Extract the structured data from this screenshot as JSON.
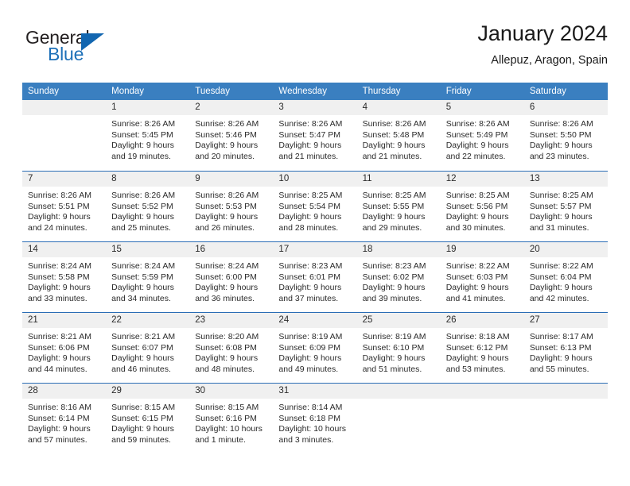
{
  "brand": {
    "word_one": "General",
    "word_two": "Blue",
    "icon": "triangle-flag-icon"
  },
  "header": {
    "title": "January 2024",
    "subtitle": "Allepuz, Aragon, Spain"
  },
  "colors": {
    "header_blue": "#3a7fc0",
    "rule_blue": "#2a6db5",
    "daynum_band": "#f0f0f0",
    "brand_blue": "#1d70b8",
    "text": "#2b2b2b"
  },
  "weekdays": [
    "Sunday",
    "Monday",
    "Tuesday",
    "Wednesday",
    "Thursday",
    "Friday",
    "Saturday"
  ],
  "weeks": [
    [
      {
        "day": "",
        "lines": []
      },
      {
        "day": "1",
        "lines": [
          "Sunrise: 8:26 AM",
          "Sunset: 5:45 PM",
          "Daylight: 9 hours",
          "and 19 minutes."
        ]
      },
      {
        "day": "2",
        "lines": [
          "Sunrise: 8:26 AM",
          "Sunset: 5:46 PM",
          "Daylight: 9 hours",
          "and 20 minutes."
        ]
      },
      {
        "day": "3",
        "lines": [
          "Sunrise: 8:26 AM",
          "Sunset: 5:47 PM",
          "Daylight: 9 hours",
          "and 21 minutes."
        ]
      },
      {
        "day": "4",
        "lines": [
          "Sunrise: 8:26 AM",
          "Sunset: 5:48 PM",
          "Daylight: 9 hours",
          "and 21 minutes."
        ]
      },
      {
        "day": "5",
        "lines": [
          "Sunrise: 8:26 AM",
          "Sunset: 5:49 PM",
          "Daylight: 9 hours",
          "and 22 minutes."
        ]
      },
      {
        "day": "6",
        "lines": [
          "Sunrise: 8:26 AM",
          "Sunset: 5:50 PM",
          "Daylight: 9 hours",
          "and 23 minutes."
        ]
      }
    ],
    [
      {
        "day": "7",
        "lines": [
          "Sunrise: 8:26 AM",
          "Sunset: 5:51 PM",
          "Daylight: 9 hours",
          "and 24 minutes."
        ]
      },
      {
        "day": "8",
        "lines": [
          "Sunrise: 8:26 AM",
          "Sunset: 5:52 PM",
          "Daylight: 9 hours",
          "and 25 minutes."
        ]
      },
      {
        "day": "9",
        "lines": [
          "Sunrise: 8:26 AM",
          "Sunset: 5:53 PM",
          "Daylight: 9 hours",
          "and 26 minutes."
        ]
      },
      {
        "day": "10",
        "lines": [
          "Sunrise: 8:25 AM",
          "Sunset: 5:54 PM",
          "Daylight: 9 hours",
          "and 28 minutes."
        ]
      },
      {
        "day": "11",
        "lines": [
          "Sunrise: 8:25 AM",
          "Sunset: 5:55 PM",
          "Daylight: 9 hours",
          "and 29 minutes."
        ]
      },
      {
        "day": "12",
        "lines": [
          "Sunrise: 8:25 AM",
          "Sunset: 5:56 PM",
          "Daylight: 9 hours",
          "and 30 minutes."
        ]
      },
      {
        "day": "13",
        "lines": [
          "Sunrise: 8:25 AM",
          "Sunset: 5:57 PM",
          "Daylight: 9 hours",
          "and 31 minutes."
        ]
      }
    ],
    [
      {
        "day": "14",
        "lines": [
          "Sunrise: 8:24 AM",
          "Sunset: 5:58 PM",
          "Daylight: 9 hours",
          "and 33 minutes."
        ]
      },
      {
        "day": "15",
        "lines": [
          "Sunrise: 8:24 AM",
          "Sunset: 5:59 PM",
          "Daylight: 9 hours",
          "and 34 minutes."
        ]
      },
      {
        "day": "16",
        "lines": [
          "Sunrise: 8:24 AM",
          "Sunset: 6:00 PM",
          "Daylight: 9 hours",
          "and 36 minutes."
        ]
      },
      {
        "day": "17",
        "lines": [
          "Sunrise: 8:23 AM",
          "Sunset: 6:01 PM",
          "Daylight: 9 hours",
          "and 37 minutes."
        ]
      },
      {
        "day": "18",
        "lines": [
          "Sunrise: 8:23 AM",
          "Sunset: 6:02 PM",
          "Daylight: 9 hours",
          "and 39 minutes."
        ]
      },
      {
        "day": "19",
        "lines": [
          "Sunrise: 8:22 AM",
          "Sunset: 6:03 PM",
          "Daylight: 9 hours",
          "and 41 minutes."
        ]
      },
      {
        "day": "20",
        "lines": [
          "Sunrise: 8:22 AM",
          "Sunset: 6:04 PM",
          "Daylight: 9 hours",
          "and 42 minutes."
        ]
      }
    ],
    [
      {
        "day": "21",
        "lines": [
          "Sunrise: 8:21 AM",
          "Sunset: 6:06 PM",
          "Daylight: 9 hours",
          "and 44 minutes."
        ]
      },
      {
        "day": "22",
        "lines": [
          "Sunrise: 8:21 AM",
          "Sunset: 6:07 PM",
          "Daylight: 9 hours",
          "and 46 minutes."
        ]
      },
      {
        "day": "23",
        "lines": [
          "Sunrise: 8:20 AM",
          "Sunset: 6:08 PM",
          "Daylight: 9 hours",
          "and 48 minutes."
        ]
      },
      {
        "day": "24",
        "lines": [
          "Sunrise: 8:19 AM",
          "Sunset: 6:09 PM",
          "Daylight: 9 hours",
          "and 49 minutes."
        ]
      },
      {
        "day": "25",
        "lines": [
          "Sunrise: 8:19 AM",
          "Sunset: 6:10 PM",
          "Daylight: 9 hours",
          "and 51 minutes."
        ]
      },
      {
        "day": "26",
        "lines": [
          "Sunrise: 8:18 AM",
          "Sunset: 6:12 PM",
          "Daylight: 9 hours",
          "and 53 minutes."
        ]
      },
      {
        "day": "27",
        "lines": [
          "Sunrise: 8:17 AM",
          "Sunset: 6:13 PM",
          "Daylight: 9 hours",
          "and 55 minutes."
        ]
      }
    ],
    [
      {
        "day": "28",
        "lines": [
          "Sunrise: 8:16 AM",
          "Sunset: 6:14 PM",
          "Daylight: 9 hours",
          "and 57 minutes."
        ]
      },
      {
        "day": "29",
        "lines": [
          "Sunrise: 8:15 AM",
          "Sunset: 6:15 PM",
          "Daylight: 9 hours",
          "and 59 minutes."
        ]
      },
      {
        "day": "30",
        "lines": [
          "Sunrise: 8:15 AM",
          "Sunset: 6:16 PM",
          "Daylight: 10 hours",
          "and 1 minute."
        ]
      },
      {
        "day": "31",
        "lines": [
          "Sunrise: 8:14 AM",
          "Sunset: 6:18 PM",
          "Daylight: 10 hours",
          "and 3 minutes."
        ]
      },
      {
        "day": "",
        "lines": []
      },
      {
        "day": "",
        "lines": []
      },
      {
        "day": "",
        "lines": []
      }
    ]
  ]
}
